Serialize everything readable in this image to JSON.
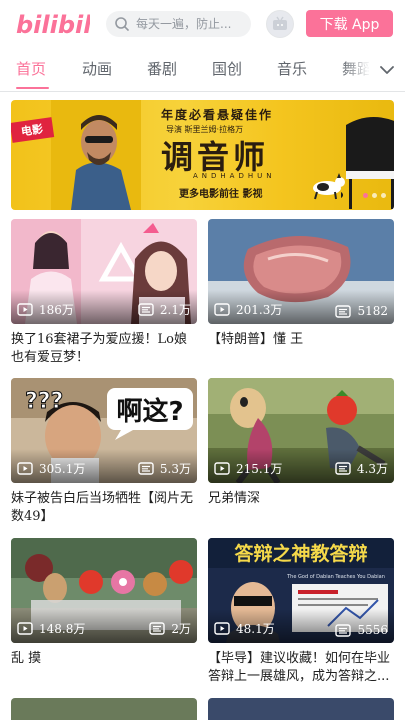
{
  "header": {
    "logo_text": "bilibili",
    "search_placeholder": "每天一遍，防止...",
    "download_label": "下载 App"
  },
  "tabs": [
    "首页",
    "动画",
    "番剧",
    "国创",
    "音乐",
    "舞蹈"
  ],
  "active_tab": 0,
  "banner": {
    "tag": "电影",
    "subtitle": "年度必看悬疑佳作",
    "cast": "导演 斯里兰姆·拉格万",
    "title": "调音师",
    "title_en": "ANDHADHUN",
    "more": "更多电影前往 影视",
    "dots": 3,
    "active_dot": 0
  },
  "videos": [
    {
      "views": "186万",
      "danmaku": "2.1万",
      "title": "换了16套裙子为爱应援！Lo娘也有爱豆梦！",
      "thumb": "pink-girl"
    },
    {
      "views": "201.3万",
      "danmaku": "5182",
      "title": "【特朗普】懂 王",
      "thumb": "meat"
    },
    {
      "views": "305.1万",
      "danmaku": "5.3万",
      "title": "妹子被告白后当场牺牲【阅片无数49】",
      "thumb": "man-react",
      "overlay_q": "???",
      "overlay_text": "啊这?"
    },
    {
      "views": "215.1万",
      "danmaku": "4.3万",
      "title": "兄弟情深",
      "thumb": "horse-grass"
    },
    {
      "views": "148.8万",
      "danmaku": "2万",
      "title": "乱 摸",
      "thumb": "group-heads"
    },
    {
      "views": "48.1万",
      "danmaku": "5556",
      "title": "【毕导】建议收藏！如何在毕业答辩上一展雄风，成为答辩之...",
      "thumb": "lecture",
      "overlay_text": "答辩之神教答辩",
      "overlay_sub": "The God of Dabian Teaches You Dabian"
    }
  ],
  "colors": {
    "brand": "#fb7299",
    "text": "#212121",
    "muted": "#61666d"
  }
}
